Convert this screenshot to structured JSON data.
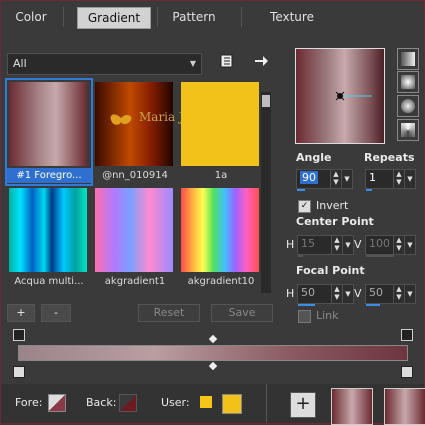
{
  "tabs": [
    "Color",
    "Gradient",
    "Pattern",
    "Texture"
  ],
  "active_tab": "Gradient",
  "filter": {
    "value": "All"
  },
  "gradients": [
    {
      "label": "#1 Foregro..."
    },
    {
      "label": "@nn_010914"
    },
    {
      "label": "1a"
    },
    {
      "label": "Acqua multi..."
    },
    {
      "label": "akgradient1"
    },
    {
      "label": "akgradient10"
    }
  ],
  "watermark": "Maria José",
  "buttons": {
    "add": "+",
    "remove": "-",
    "reset": "Reset",
    "save": "Save"
  },
  "angle": {
    "label": "Angle",
    "value": "90"
  },
  "repeats": {
    "label": "Repeats",
    "value": "1"
  },
  "invert": {
    "label": "Invert",
    "checked": true
  },
  "center": {
    "label": "Center Point",
    "h_label": "H",
    "h": "15",
    "v_label": "V",
    "v": "100"
  },
  "focal": {
    "label": "Focal Point",
    "h_label": "H",
    "h": "50",
    "v_label": "V",
    "v": "50"
  },
  "link": {
    "label": "Link"
  },
  "footer": {
    "fore": "Fore:",
    "back": "Back:",
    "user": "User:",
    "add": "+"
  },
  "colors": {
    "selection": "#2e7ad6",
    "user1": "#f5c518",
    "user2": "#f2c21a"
  }
}
